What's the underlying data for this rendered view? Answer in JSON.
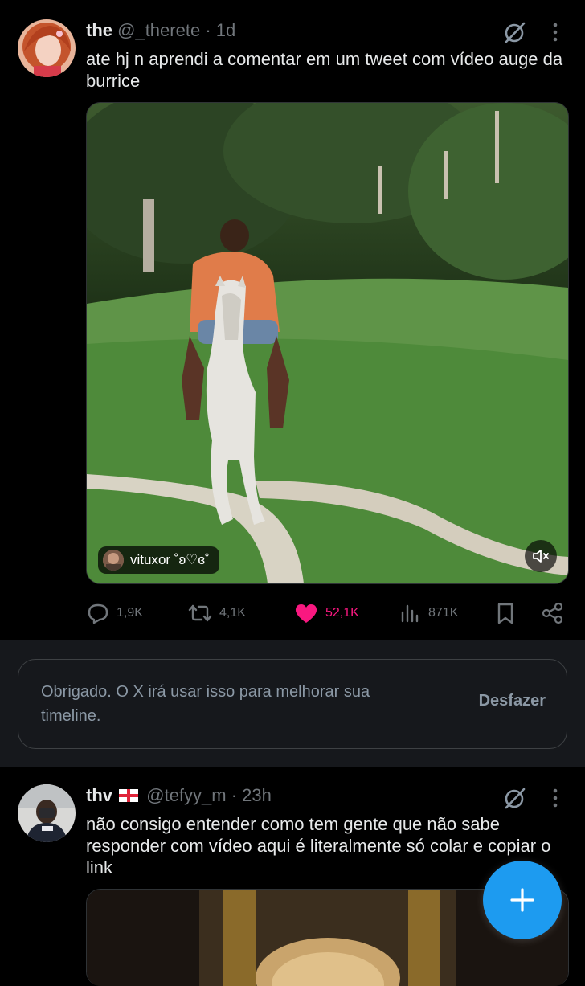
{
  "tweet1": {
    "name": "the",
    "handle": "@_therete",
    "time": "· 1d",
    "text": "ate hj n aprendi a comentar em um tweet com vídeo auge da burrice",
    "video_tag": "vituxor ˚ʚ♡ɞ˚",
    "actions": {
      "replies": "1,9K",
      "reposts": "4,1K",
      "likes": "52,1K",
      "views": "871K"
    }
  },
  "notice": {
    "text": "Obrigado. O X irá usar isso para melhorar sua timeline.",
    "undo_label": "Desfazer"
  },
  "tweet2": {
    "name": "thv",
    "flag": "🏴",
    "handle": "@tefyy_m",
    "time": "· 23h",
    "text": "não consigo entender como tem gente que não sabe responder com vídeo aqui é literalmente só colar e copiar o link"
  },
  "colors": {
    "accent": "#1d9bf0",
    "like": "#f91880",
    "muted": "#71767b",
    "text": "#e7e9ea"
  },
  "icons": {
    "reply": "reply-icon",
    "repost": "repost-icon",
    "like": "heart-icon",
    "views": "views-icon",
    "bookmark": "bookmark-icon",
    "share": "share-icon",
    "mute": "mute-icon",
    "compose": "plus-icon",
    "grok": "grok-icon",
    "more": "more-icon"
  }
}
